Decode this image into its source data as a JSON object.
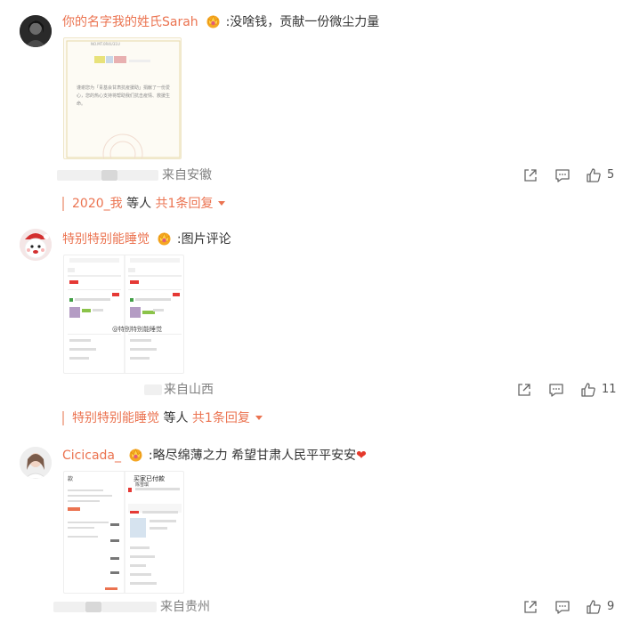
{
  "comments": [
    {
      "username": "你的名字我的姓氏Sarah",
      "text": ":没啥钱，贡献一份微尘力量",
      "location": "来自安徽",
      "likes": "5",
      "reply": {
        "user": "2020_我",
        "middle": " 等人 ",
        "count": "共1条回复"
      },
      "image_text": {
        "code": "NO.MT.0R4U31U",
        "body": "谨谢您为「青基会甘肃抗疫援助」捐献了一份爱心，您的热心支持将帮助我们抗击疫情、救援生命。"
      }
    },
    {
      "username": "特别特别能睡觉",
      "text": ":图片评论",
      "location": "来自山西",
      "likes": "11",
      "reply": {
        "user": "特别特别能睡觉",
        "middle": " 等人 ",
        "count": "共1条回复"
      },
      "image_text": {
        "overlay": "@特别特别能睡觉"
      }
    },
    {
      "username": "Cicicada_",
      "text": ":略尽绵薄之力 希望甘肃人民平平安安",
      "heart": "❤",
      "location": "来自贵州",
      "likes": "9",
      "image_text": {
        "left_header": "款",
        "right_header": "买家已付款",
        "seller": "陈雪琪"
      }
    }
  ],
  "colors": {
    "username": "#eb7350",
    "meta": "#808080",
    "heart": "#e5392b"
  },
  "icons": [
    "share-icon",
    "comment-icon",
    "like-icon",
    "caret-down-icon"
  ]
}
